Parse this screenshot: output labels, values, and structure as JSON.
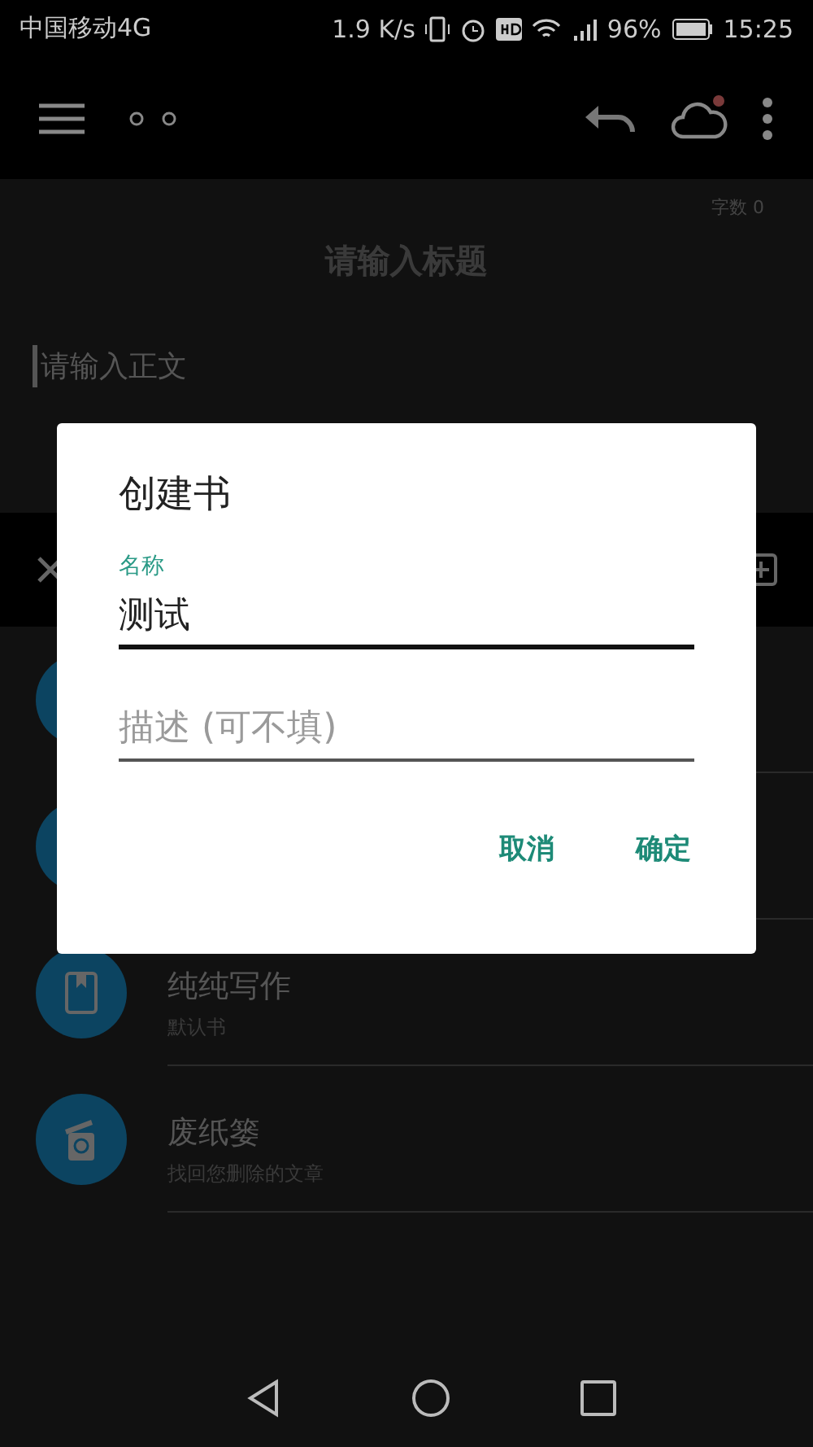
{
  "status_bar": {
    "carrier": "中国移动4G",
    "speed": "1.9 K/s",
    "battery": "96%",
    "time": "15:25"
  },
  "app_bar": {
    "sync_badge": true
  },
  "editor": {
    "word_count": "字数 0",
    "title_placeholder": "请输入标题",
    "body_placeholder": "请输入正文"
  },
  "books": [
    {
      "kind": "hidden"
    },
    {
      "kind": "hidden"
    },
    {
      "kind": "book",
      "title": "纯纯写作",
      "subtitle": "默认书"
    },
    {
      "kind": "trash",
      "title": "废纸篓",
      "subtitle": "找回您删除的文章"
    }
  ],
  "dialog": {
    "title": "创建书",
    "fields": [
      {
        "label": "名称",
        "value": "测试",
        "focused": true
      },
      {
        "placeholder": "描述 (可不填)",
        "focused": false
      }
    ],
    "buttons": [
      "取消",
      "确定"
    ]
  }
}
